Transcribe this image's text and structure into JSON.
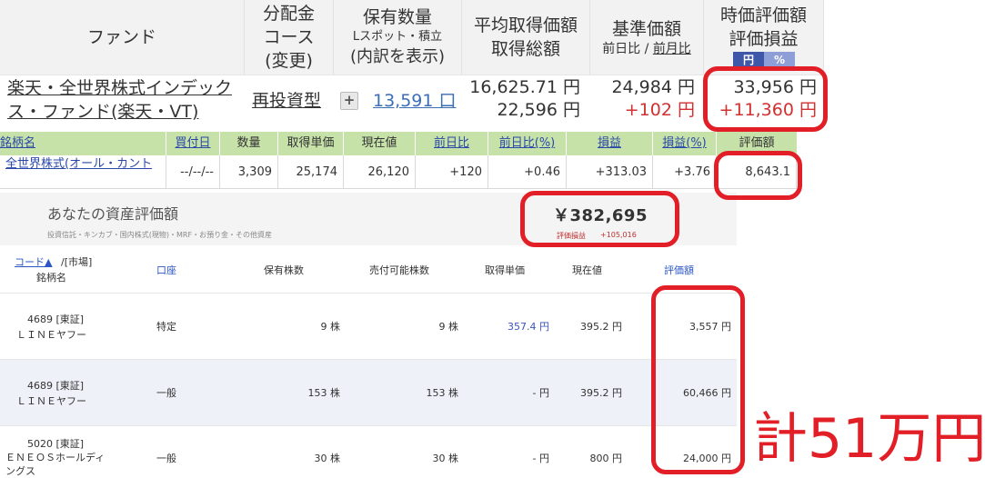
{
  "fund_table": {
    "headers": {
      "fund": "ファンド",
      "course_l1": "分配金",
      "course_l2": "コース",
      "course_l3": "(変更)",
      "qty_l1": "保有数量",
      "qty_l2": "Lスポット・積立",
      "qty_l3": "(内訳を表示)",
      "avg_l1": "平均取得価額",
      "avg_l2": "取得総額",
      "base_l1": "基準価額",
      "base_l2a": "前日比 /",
      "base_l2b": "前月比",
      "mv_l1": "時価評価額",
      "mv_l2": "評価損益",
      "toggle_yen": "円",
      "toggle_pct": "%"
    },
    "row": {
      "fund_name": "楽天・全世界株式インデックス・ファンド(楽天・VT)",
      "course": "再投資型",
      "expand_icon": "plus-icon",
      "quantity": "13,591 口",
      "avg_price": "16,625.71 円",
      "total_cost": "22,596 円",
      "base_price": "24,984 円",
      "daily_change": "+102 円",
      "market_value": "33,956 円",
      "unrealized_pl": "+11,360 円"
    }
  },
  "portfolio_table": {
    "headers": [
      "銘柄名",
      "買付日",
      "数量",
      "取得単価",
      "現在値",
      "前日比",
      "前日比(%)",
      "損益",
      "損益(%)",
      "評価額"
    ],
    "row": [
      "全世界株式(オール・カント",
      "--/--/--",
      "3,309",
      "25,174",
      "26,120",
      "+120",
      "+0.46",
      "+313.03",
      "+3.76",
      "8,643.1"
    ]
  },
  "asset_summary": {
    "title": "あなたの資産評価額",
    "subtitle": "投資信託・キンカブ・国内株式(現物)・MRF・お預り金・その他資産",
    "total": "￥382,695",
    "pl_label": "評価損益",
    "pl_value": "+105,016"
  },
  "stock_table": {
    "headers": {
      "code": "コード▲",
      "market": "/[市場]",
      "name": "銘柄名",
      "account": "口座",
      "held": "保有株数",
      "sellable": "売付可能株数",
      "cost": "取得単価",
      "price": "現在値",
      "value": "評価額"
    },
    "rows": [
      {
        "code": "4689 [東証]",
        "name": "ＬＩＮＥヤフー",
        "account": "特定",
        "held": "9 株",
        "sellable": "9 株",
        "cost": "357.4 円",
        "price": "395.2 円",
        "value": "3,557 円"
      },
      {
        "code": "4689 [東証]",
        "name": "ＬＩＮＥヤフー",
        "account": "一般",
        "held": "153 株",
        "sellable": "153 株",
        "cost": "- 円",
        "price": "395.2 円",
        "value": "60,466 円"
      },
      {
        "code": "5020 [東証]",
        "name": "ＥＮＥＯＳホールディングス",
        "account": "一般",
        "held": "30 株",
        "sellable": "30 株",
        "cost": "- 円",
        "price": "800 円",
        "value": "24,000 円"
      }
    ]
  },
  "annotation": {
    "total_text": "計51万円",
    "color": "#e21e26"
  }
}
